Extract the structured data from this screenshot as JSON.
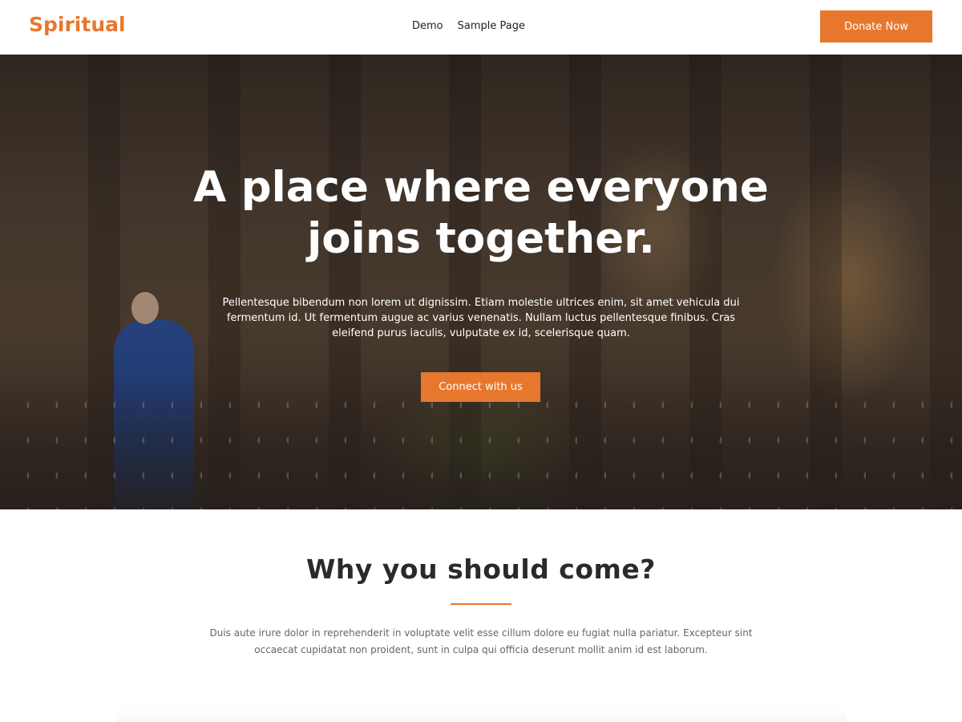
{
  "header": {
    "logo": "Spiritual",
    "nav": [
      {
        "label": "Demo"
      },
      {
        "label": "Sample Page"
      }
    ],
    "donate_label": "Donate Now"
  },
  "hero": {
    "title": "A place where everyone joins together.",
    "text": "Pellentesque bibendum non lorem ut dignissim. Etiam molestie ultrices enim, sit amet vehicula dui fermentum id. Ut fermentum augue ac varius venenatis. Nullam luctus pellentesque finibus. Cras eleifend purus iaculis, vulputate ex id, scelerisque quam.",
    "cta_label": "Connect with us"
  },
  "why": {
    "title": "Why you should come?",
    "text": "Duis aute irure dolor in reprehenderit in voluptate velit esse cillum dolore eu fugiat nulla pariatur. Excepteur sint occaecat cupidatat non proident, sunt in culpa qui officia deserunt mollit anim id est laborum."
  },
  "colors": {
    "accent": "#e8772e",
    "text_dark": "#2a2a2a",
    "text_muted": "#666666"
  }
}
